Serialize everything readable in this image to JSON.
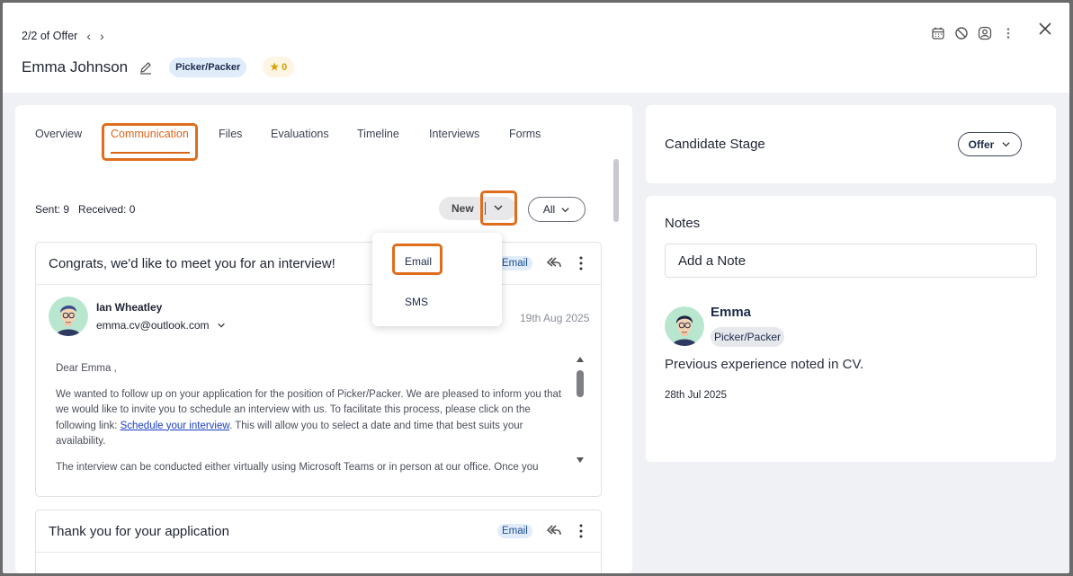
{
  "header": {
    "pagination": "2/2 of Offer",
    "candidate_name": "Emma Johnson",
    "role_badge": "Picker/Packer",
    "rating": "0"
  },
  "tabs": [
    {
      "label": "Overview"
    },
    {
      "label": "Communication"
    },
    {
      "label": "Files"
    },
    {
      "label": "Evaluations"
    },
    {
      "label": "Timeline"
    },
    {
      "label": "Interviews"
    },
    {
      "label": "Forms"
    }
  ],
  "communication": {
    "sent_label": "Sent: 9",
    "received_label": "Received: 0",
    "new_label": "New",
    "filter_label": "All",
    "dropdown_options": [
      "Email",
      "SMS"
    ],
    "messages": [
      {
        "title": "Congrats, we'd like to meet you for an interview!",
        "channel": "Email",
        "sender_name": "Ian Wheatley",
        "sender_email": "emma.cv@outlook.com",
        "date": "19th Aug 2025",
        "greeting": "Dear Emma ,",
        "body_1a": "We wanted to follow up on your application for the position of Picker/Packer. We are pleased to inform you that we would like to invite you to schedule an interview with us. To facilitate this process, please click on the following link: ",
        "link_text": "Schedule your interview",
        "body_1b": ". This will allow you to select a date and time that best suits your availability.",
        "body_2": "The interview can be conducted either virtually using Microsoft Teams or in person at our office. Once you"
      },
      {
        "title": "Thank you for your application",
        "channel": "Email"
      }
    ]
  },
  "stage": {
    "label": "Candidate Stage",
    "value": "Offer"
  },
  "notes": {
    "label": "Notes",
    "placeholder": "Add a Note",
    "items": [
      {
        "author": "Emma",
        "role": "Picker/Packer",
        "text": "Previous experience noted in CV.",
        "date": "28th Jul 2025"
      }
    ]
  },
  "colors": {
    "accent": "#d9651a",
    "highlight": "#e06d1e",
    "badge_bg": "#e1ecfb",
    "link": "#1a3fc7"
  }
}
